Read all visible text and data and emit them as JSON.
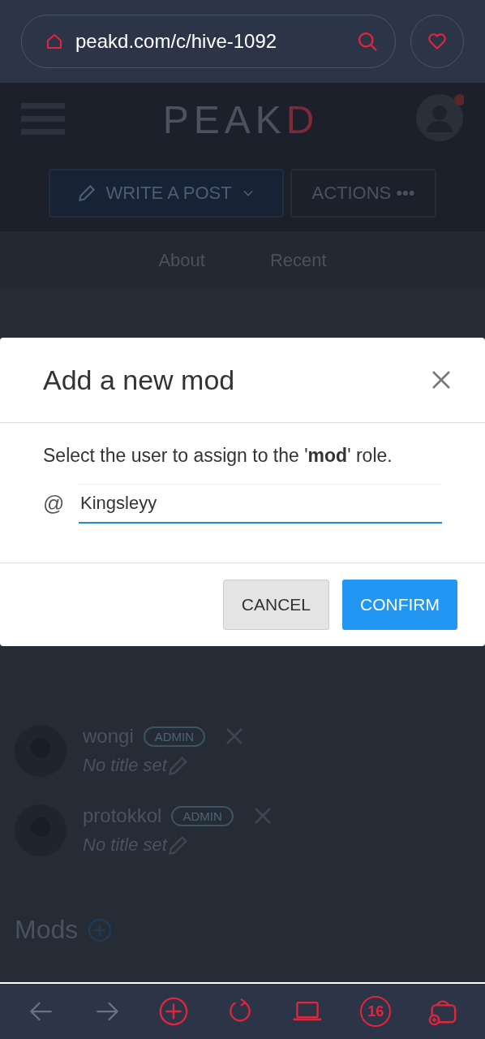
{
  "browser": {
    "url": "peakd.com/c/hive-1092",
    "tab_count": "16"
  },
  "header": {
    "logo_main": "PEAK",
    "logo_accent": "D"
  },
  "actions": {
    "write": "WRITE A POST",
    "more": "ACTIONS •••"
  },
  "tabs": [
    "About",
    "Recent"
  ],
  "admins": [
    {
      "name": "wongi",
      "role": "ADMIN",
      "title": "No title set"
    },
    {
      "name": "protokkol",
      "role": "ADMIN",
      "title": "No title set"
    }
  ],
  "mods_heading": "Mods",
  "dialog": {
    "title": "Add a new mod",
    "message": "Select the user to assign to the '**mod**' role.",
    "at": "@",
    "value": "Kingsleyy",
    "cancel": "CANCEL",
    "confirm": "CONFIRM"
  }
}
